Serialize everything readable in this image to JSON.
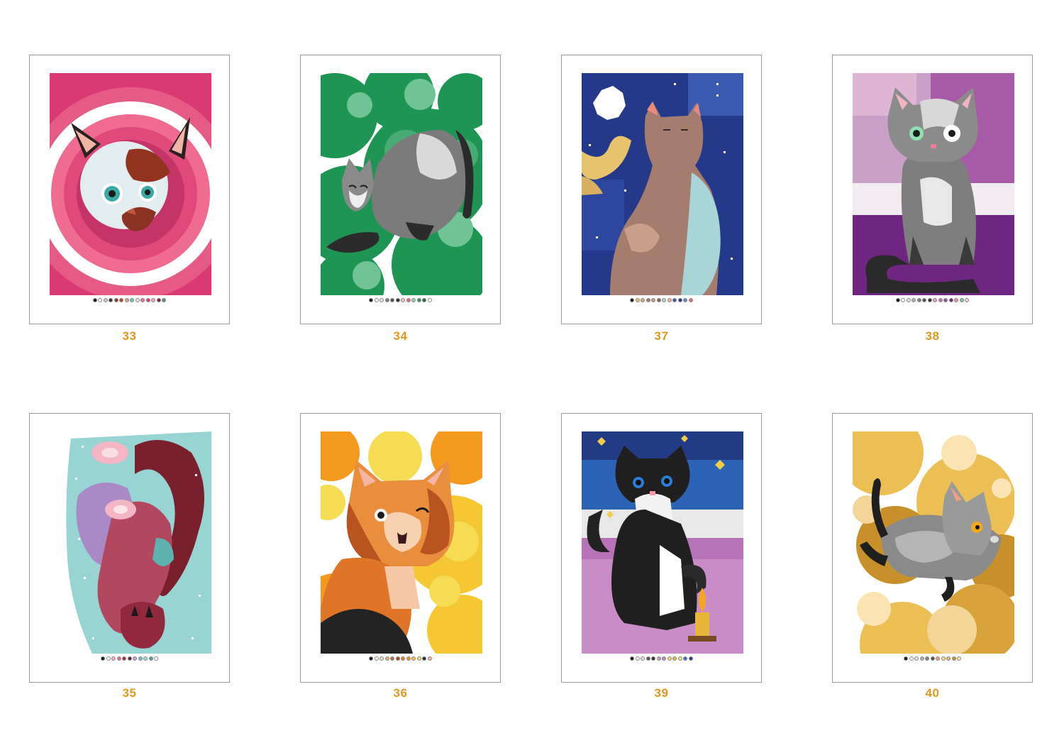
{
  "pages": [
    {
      "number": "33",
      "palette": [
        "#1a1a1a",
        "#ffffff",
        "#c9c0d8",
        "#3b2a2a",
        "#8c3a2a",
        "#b0482c",
        "#e0a080",
        "#6cc6c0",
        "#e6e6e6",
        "#f06c8c",
        "#e03a70",
        "#f4a4b4",
        "#8b1a3a",
        "#5a9090"
      ]
    },
    {
      "number": "34",
      "palette": [
        "#1a1a1a",
        "#ffffff",
        "#e0e0e0",
        "#7a7a7a",
        "#555555",
        "#333333",
        "#f4c0b8",
        "#e46a7a",
        "#8cd4a8",
        "#2a9a5a",
        "#1c6a3c",
        "#ffffff"
      ]
    },
    {
      "number": "37",
      "palette": [
        "#1a1a1a",
        "#e8c070",
        "#d4a870",
        "#a07a6a",
        "#c49a88",
        "#8a6050",
        "#b0d8dc",
        "#f0b0a0",
        "#3a58a8",
        "#243a80",
        "#6a86d0",
        "#e07070"
      ]
    },
    {
      "number": "38",
      "palette": [
        "#1a1a1a",
        "#ffffff",
        "#e0e0e0",
        "#b0b0b0",
        "#808080",
        "#555555",
        "#333333",
        "#e0a0c8",
        "#c070b0",
        "#9a4aa0",
        "#6a2a80",
        "#f090a0",
        "#80c0a0",
        "#f4d0e0"
      ]
    },
    {
      "number": "35",
      "palette": [
        "#1a1a1a",
        "#ffffff",
        "#f4b0c0",
        "#e07090",
        "#a03050",
        "#6a1a30",
        "#c0a0d0",
        "#70c0c0",
        "#9ad8d8",
        "#4aa0a0",
        "#ffffff"
      ]
    },
    {
      "number": "36",
      "palette": [
        "#1a1a1a",
        "#ffffff",
        "#f4d8b0",
        "#e0b080",
        "#c07040",
        "#a04a20",
        "#e08030",
        "#f09020",
        "#f8c040",
        "#f4e070",
        "#2a2a2a",
        "#f4b0a0"
      ]
    },
    {
      "number": "39",
      "palette": [
        "#1a1a1a",
        "#ffffff",
        "#e0e0e0",
        "#555555",
        "#333333",
        "#c0a0c8",
        "#c080c0",
        "#f0d070",
        "#e8b030",
        "#f4e090",
        "#3a70c0",
        "#243a80"
      ]
    },
    {
      "number": "40",
      "palette": [
        "#1a1a1a",
        "#ffffff",
        "#e0e0e0",
        "#b0b0b0",
        "#808080",
        "#555555",
        "#f0a080",
        "#f8d888",
        "#e8b850",
        "#c8902a",
        "#f4e0b0"
      ]
    }
  ]
}
